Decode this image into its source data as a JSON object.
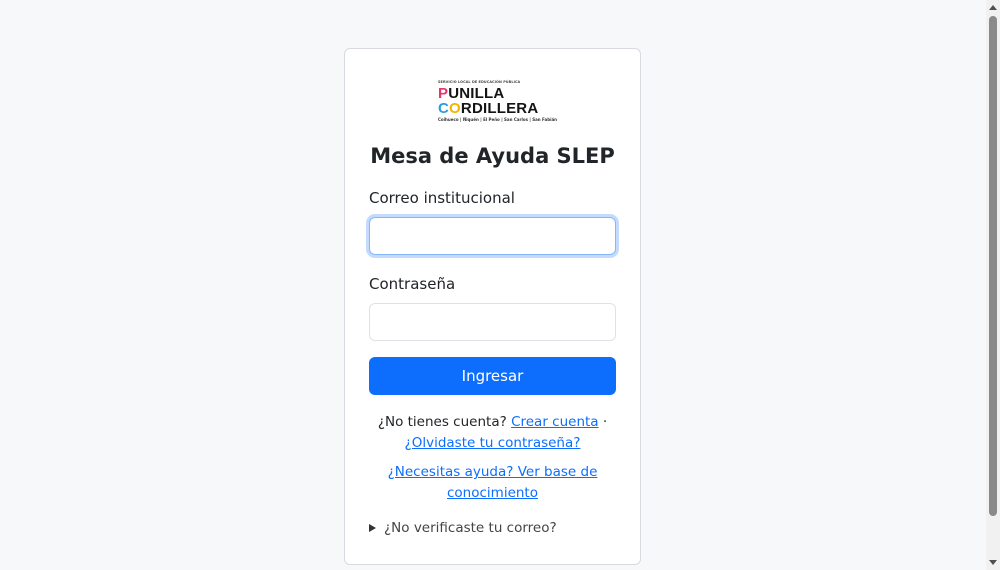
{
  "logo": {
    "tagline": "SERVICIO LOCAL DE EDUCACIÓN PÚBLICA",
    "line1": "PUNILLA",
    "line2": "CORDILLERA",
    "communes": "Coihueco | Ñiquén | El Peño | San Carlos | San Fabián"
  },
  "title": "Mesa de Ayuda SLEP",
  "form": {
    "email_label": "Correo institucional",
    "email_value": "",
    "password_label": "Contraseña",
    "password_value": "",
    "submit_label": "Ingresar"
  },
  "links": {
    "no_account_text": "¿No tienes cuenta?",
    "create_account": "Crear cuenta",
    "separator": "·",
    "forgot_password": "¿Olvidaste tu contraseña?",
    "help": "¿Necesitas ayuda? Ver base de conocimiento"
  },
  "details": {
    "summary": "¿No verificaste tu correo?"
  },
  "colors": {
    "primary": "#0d6efd",
    "focus_ring": "#86b7fe",
    "logo_pink": "#e8336b",
    "logo_blue": "#2a9ed8",
    "logo_yellow": "#f4b400"
  }
}
